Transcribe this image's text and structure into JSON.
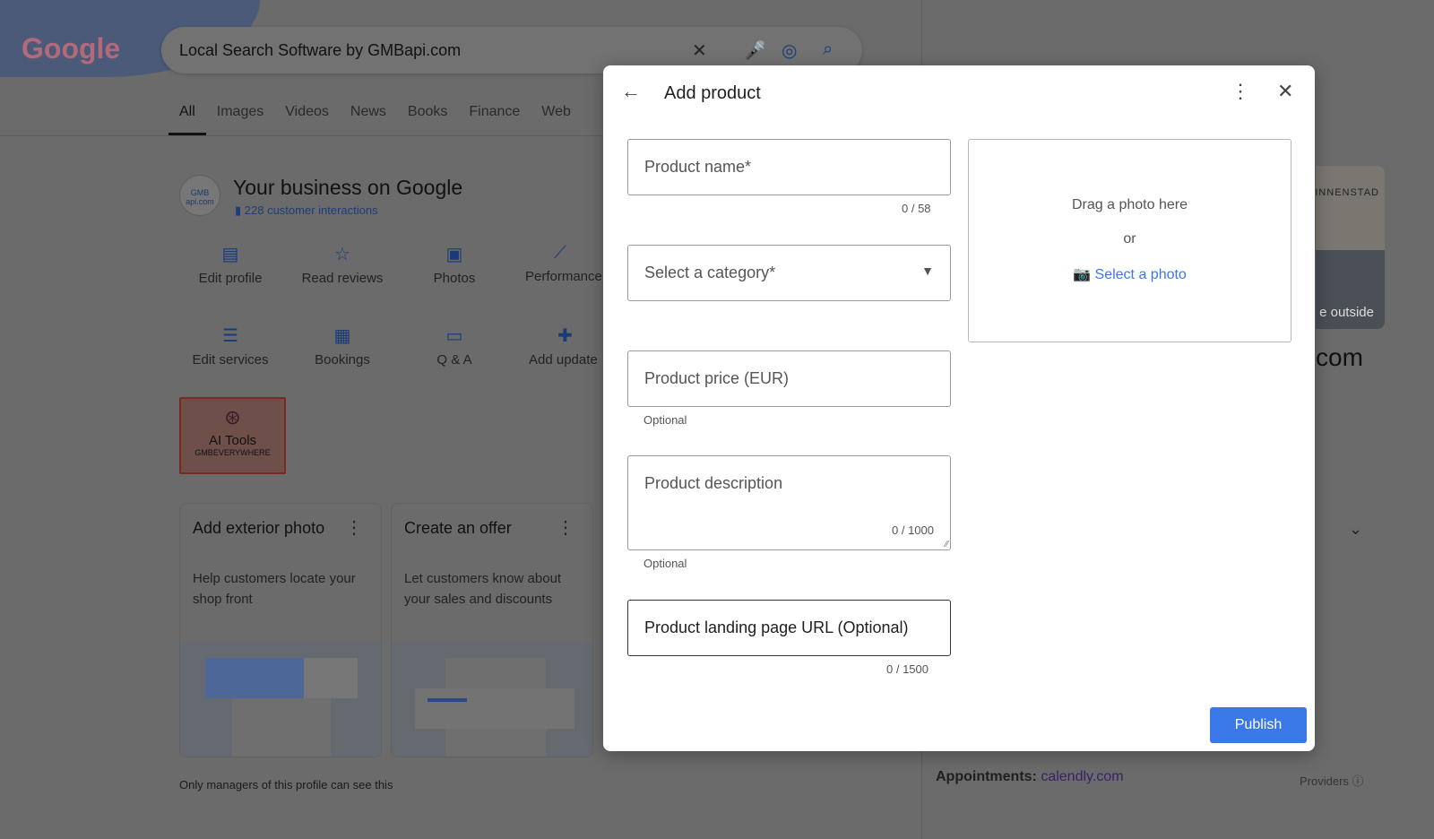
{
  "google": {
    "logo": "Google",
    "query": "Local Search Software by GMBapi.com"
  },
  "tabs": [
    "All",
    "Images",
    "Videos",
    "News",
    "Books",
    "Finance",
    "Web"
  ],
  "business": {
    "logo_text": "GMB api.com",
    "title": "Your business on Google",
    "interactions": "228 customer interactions"
  },
  "actions": [
    {
      "label": "Edit profile",
      "icon": "storefront-icon"
    },
    {
      "label": "Read reviews",
      "icon": "review-icon"
    },
    {
      "label": "Photos",
      "icon": "image-icon"
    },
    {
      "label": "Performance",
      "icon": "trending-icon"
    },
    {
      "label": "Edit services",
      "icon": "list-icon"
    },
    {
      "label": "Bookings",
      "icon": "calendar-icon"
    },
    {
      "label": "Q & A",
      "icon": "forum-icon"
    },
    {
      "label": "Add update",
      "icon": "post-add-icon"
    }
  ],
  "ai_tools": {
    "title": "AI Tools",
    "subtitle": "GMBEVERYWHERE"
  },
  "cards": [
    {
      "title": "Add exterior photo",
      "text": "Help customers locate your shop front"
    },
    {
      "title": "Create an offer",
      "text": "Let customers know about your sales and discounts"
    }
  ],
  "managers_note": "Only managers of this profile can see this",
  "right_panel": {
    "map_label": "INNENSTAD",
    "photo_caption": "e outside",
    "domain_fragment": "com",
    "appointments_label": "Appointments:",
    "appointments_link": "calendly.com",
    "providers": "Providers"
  },
  "dialog": {
    "title": "Add product",
    "product_name_placeholder": "Product name*",
    "product_name_count": "0 / 58",
    "category_placeholder": "Select a category*",
    "price_placeholder": "Product price (EUR)",
    "price_hint": "Optional",
    "description_placeholder": "Product description",
    "description_count": "0 / 1000",
    "description_hint": "Optional",
    "url_placeholder": "Product landing page URL (Optional)",
    "url_count": "0 / 1500",
    "drag_text": "Drag a photo here",
    "or_text": "or",
    "select_photo": "Select a photo",
    "publish": "Publish"
  },
  "colors": {
    "accent": "#3b78e7",
    "overlay": "#6b6b6b"
  }
}
